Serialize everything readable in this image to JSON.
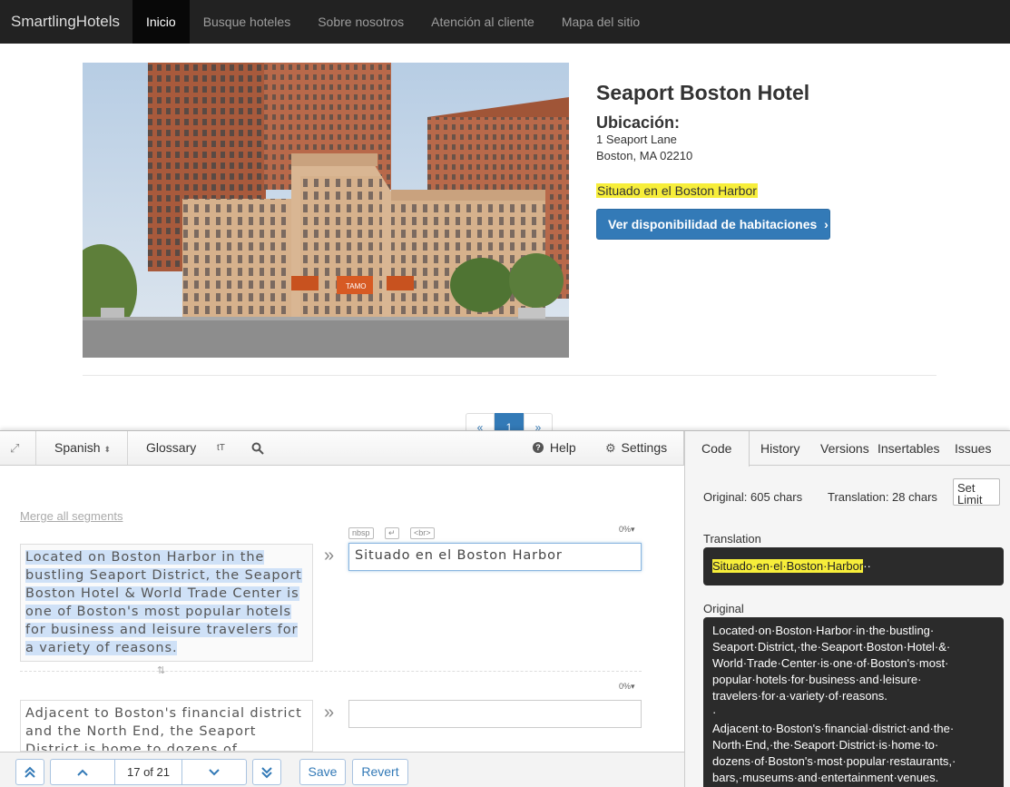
{
  "nav": {
    "brand": "SmartlingHotels",
    "items": [
      {
        "label": "Inicio",
        "active": true
      },
      {
        "label": "Busque hoteles",
        "active": false
      },
      {
        "label": "Sobre nosotros",
        "active": false
      },
      {
        "label": "Atención al cliente",
        "active": false
      },
      {
        "label": "Mapa del sitio",
        "active": false
      }
    ]
  },
  "hotel": {
    "title": "Seaport Boston Hotel",
    "location_label": "Ubicación:",
    "address_line1": "1 Seaport Lane",
    "address_line2": "Boston, MA 02210",
    "description": "Situado en el Boston Harbor",
    "button_label": "Ver disponibilidad de habitaciones",
    "photo_sign": "TAMO"
  },
  "pagination": {
    "prev": "«",
    "current": "1",
    "next": "»"
  },
  "editor": {
    "toolbar": {
      "language": "Spanish",
      "glossary": "Glossary",
      "help": "Help",
      "settings": "Settings"
    },
    "merge_label": "Merge all segments",
    "tags": {
      "nbsp": "nbsp",
      "enter": "↵",
      "br": "<br>"
    },
    "segments": [
      {
        "source": "Located on Boston Harbor in the bustling Seaport District, the Seaport Boston Hotel & World Trade Center is one of Boston's most popular hotels for business and leisure travelers for a variety of reasons.",
        "translation": "Situado en el Boston Harbor",
        "percent": "0%"
      },
      {
        "source": "Adjacent to Boston's financial district and the North End, the Seaport District is home to dozens of",
        "translation": "",
        "percent": "0%"
      }
    ],
    "bottom": {
      "position": "17 of 21",
      "save": "Save",
      "revert": "Revert"
    }
  },
  "sidebar": {
    "tabs": [
      "Code",
      "History",
      "Versions",
      "Insertables",
      "Issues"
    ],
    "active_tab": "Code",
    "original_chars": "Original: 605 chars",
    "translation_chars": "Translation: 28 chars",
    "set_limit": "Set Limit",
    "translation_label": "Translation",
    "translation_code": "Situado·en·el·Boston·Harbor",
    "translation_trailer": "··",
    "original_label": "Original",
    "original_code_1": "Located·on·Boston·Harbor·in·the·bustling· Seaport·District,·the·Seaport·Boston·Hotel·&· World·Trade·Center·is·one·of·Boston's·most· popular·hotels·for·business·and·leisure· travelers·for·a·variety·of·reasons.",
    "original_code_dot": "·",
    "original_code_2": "Adjacent·to·Boston's·financial·district·and·the· North·End,·the·Seaport·District·is·home·to· dozens·of·Boston's·most·popular·restaurants,· bars,·museums·and·entertainment·venues."
  }
}
